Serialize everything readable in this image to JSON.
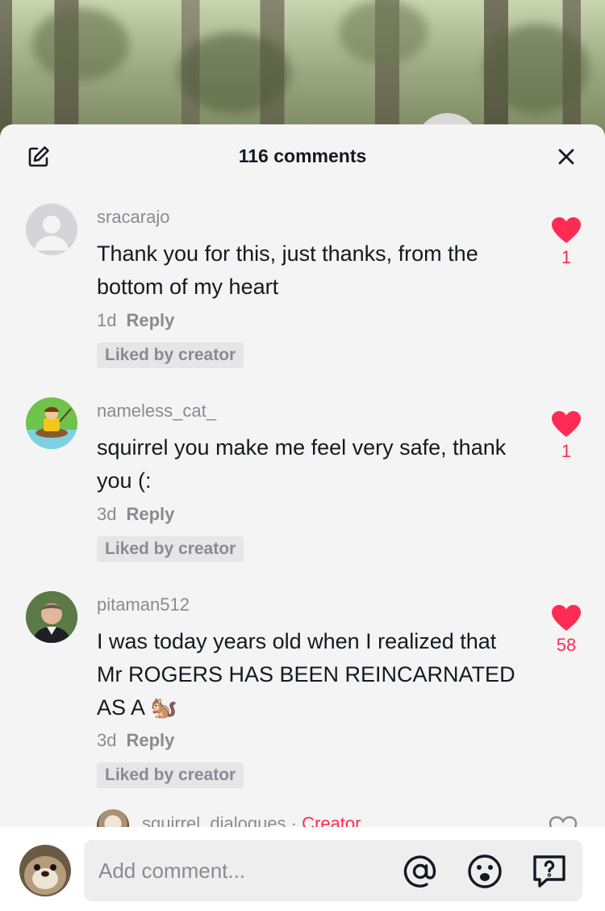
{
  "sheet": {
    "title": "116 comments"
  },
  "comments": [
    {
      "username": "sracarajo",
      "text": "Thank you for this, just thanks, from the bottom of my heart",
      "time": "1d",
      "reply_label": "Reply",
      "badge": "Liked by creator",
      "likes": "1"
    },
    {
      "username": "nameless_cat_",
      "text": "squirrel you make me feel very safe, thank you (:",
      "time": "3d",
      "reply_label": "Reply",
      "badge": "Liked by creator",
      "likes": "1"
    },
    {
      "username": "pitaman512",
      "text": "I was today years old when I realized that Mr ROGERS HAS BEEN REINCARNATED AS A 🐿️",
      "time": "3d",
      "reply_label": "Reply",
      "badge": "Liked by creator",
      "likes": "58"
    }
  ],
  "partial_comment": {
    "username": "squirrel_dialogues",
    "separator": " · ",
    "creator_label": "Creator"
  },
  "composer": {
    "placeholder": "Add comment..."
  },
  "colors": {
    "like": "#fe2c55",
    "sheet_bg": "#f4f4f4",
    "text": "#161823",
    "muted": "#8a8b91"
  },
  "icons": [
    "edit-icon",
    "close-icon",
    "heart-icon",
    "mention-icon",
    "emoji-icon",
    "question-icon"
  ]
}
